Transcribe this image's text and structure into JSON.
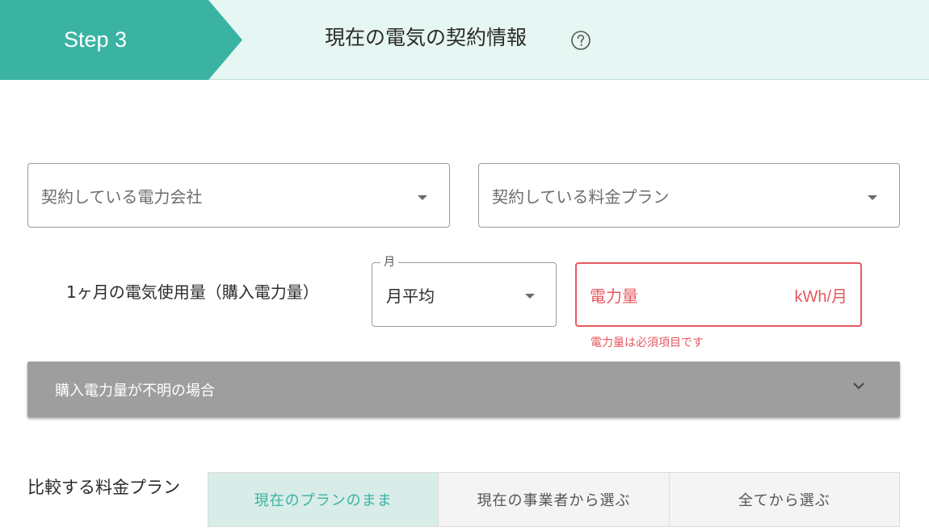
{
  "header": {
    "step_label": "Step 3",
    "title": "現在の電気の契約情報",
    "help_icon": "question-circle-icon"
  },
  "company_select": {
    "placeholder": "契約している電力会社"
  },
  "plan_select": {
    "placeholder": "契約している料金プラン"
  },
  "usage": {
    "label": "1ヶ月の電気使用量（購入電力量）",
    "month_field_label": "月",
    "month_value": "月平均",
    "power_placeholder": "電力量",
    "power_unit": "kWh/月",
    "error": "電力量は必須項目です"
  },
  "accordion": {
    "label": "購入電力量が不明の場合"
  },
  "compare": {
    "label": "比較する料金プラン",
    "tabs": [
      {
        "label": "現在のプランのまま",
        "active": true
      },
      {
        "label": "現在の事業者から選ぶ",
        "active": false
      },
      {
        "label": "全てから選ぶ",
        "active": false
      }
    ]
  },
  "colors": {
    "accent": "#3bb3a3",
    "header_bg": "#e6f6f2",
    "error": "#e5585f",
    "accordion_bg": "#9e9e9e"
  }
}
